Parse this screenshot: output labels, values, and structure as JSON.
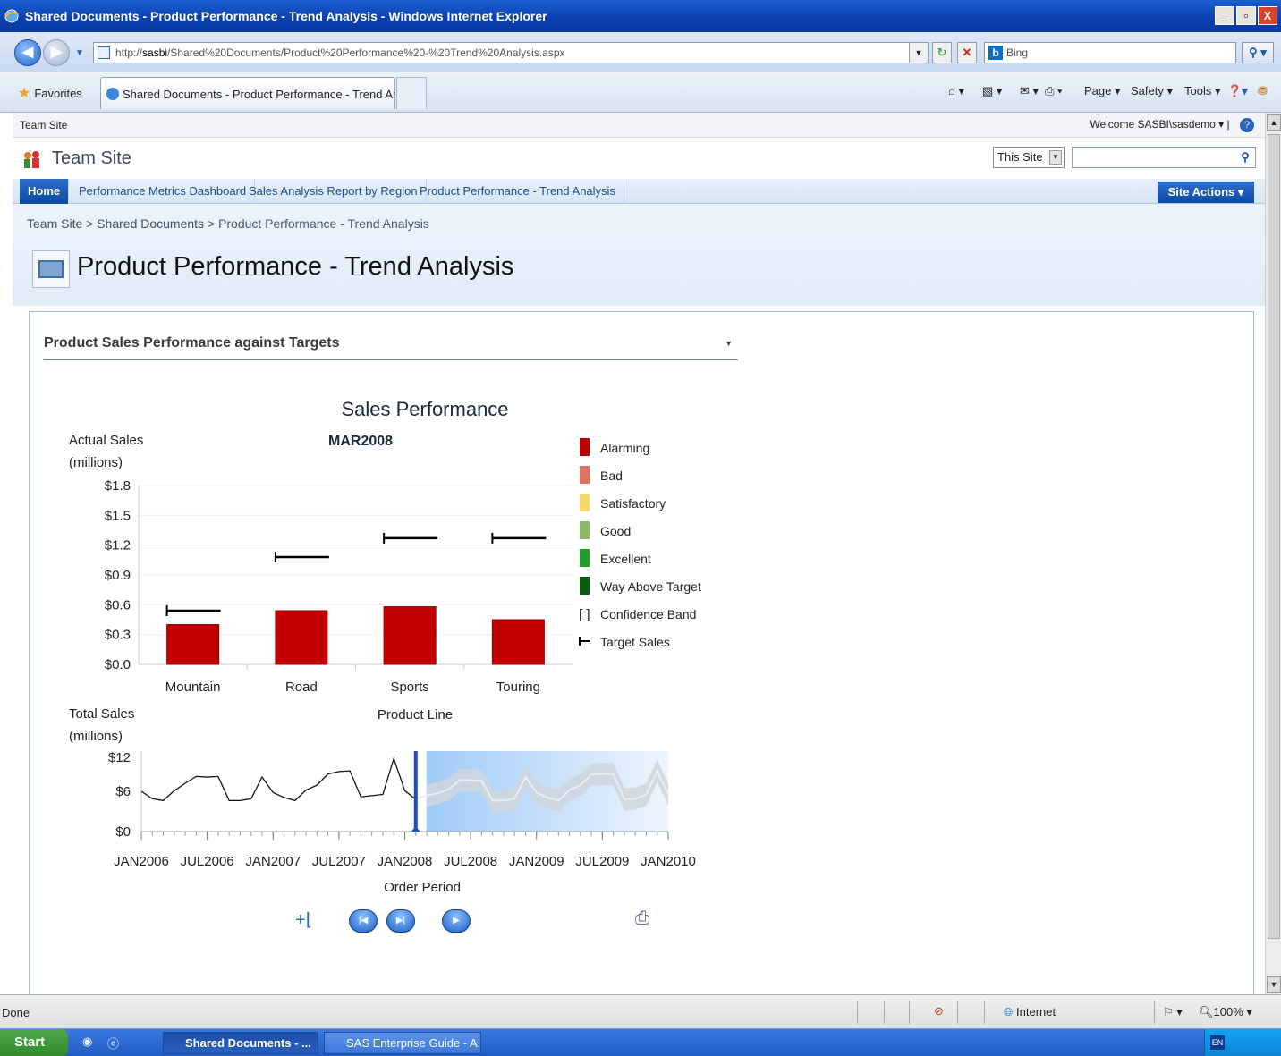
{
  "window": {
    "title": "Shared Documents - Product Performance - Trend Analysis - Windows Internet Explorer"
  },
  "browser": {
    "url_prefix": "http://",
    "url_host": "sasbi",
    "url_path": "/Shared%20Documents/Product%20Performance%20-%20Trend%20Analysis.aspx",
    "search_placeholder": "Bing",
    "favorites_label": "Favorites",
    "tab_title": "Shared Documents - Product Performance - Trend An...",
    "commands": [
      "Page",
      "Safety",
      "Tools"
    ]
  },
  "sharepoint": {
    "top_left": "Team Site",
    "welcome": "Welcome SASBI\\sasdemo",
    "site_title": "Team Site",
    "scope": "This Site",
    "nav": [
      "Home",
      "Performance Metrics Dashboard",
      "Sales Analysis Report by Region",
      "Product Performance - Trend Analysis"
    ],
    "site_actions": "Site Actions",
    "breadcrumb": [
      "Team Site",
      "Shared Documents",
      "Product Performance - Trend Analysis"
    ],
    "page_title": "Product Performance - Trend Analysis",
    "webpart_title": "Product Sales Performance against Targets"
  },
  "chart_data": [
    {
      "type": "bar",
      "title": "Sales Performance",
      "subtitle": "MAR2008",
      "ylabel": "Actual Sales (millions)",
      "xlabel": "Product Line",
      "categories": [
        "Mountain",
        "Road",
        "Sports",
        "Touring"
      ],
      "series": [
        {
          "name": "Actual Sales",
          "values": [
            0.4,
            0.54,
            0.58,
            0.45
          ]
        },
        {
          "name": "Target Sales",
          "values": [
            0.54,
            1.08,
            1.27,
            1.27
          ]
        }
      ],
      "ylim": [
        0,
        1.8
      ],
      "yticks": [
        "$1.8",
        "$1.5",
        "$1.2",
        "$0.9",
        "$0.6",
        "$0.3",
        "$0.0"
      ],
      "legend": [
        {
          "label": "Alarming",
          "color": "#c00000"
        },
        {
          "label": "Bad",
          "color": "#e07060"
        },
        {
          "label": "Satisfactory",
          "color": "#f5d76e"
        },
        {
          "label": "Good",
          "color": "#8cb862"
        },
        {
          "label": "Excellent",
          "color": "#1f9e2a"
        },
        {
          "label": "Way Above Target",
          "color": "#0c5c12"
        },
        {
          "label": "Confidence Band",
          "symbol": "[ ]"
        },
        {
          "label": "Target Sales",
          "symbol": "target-marker"
        }
      ],
      "legend_position": "right"
    },
    {
      "type": "line",
      "ylabel": "Total Sales (millions)",
      "xlabel": "Order Period",
      "xticks": [
        "JAN2006",
        "JUL2006",
        "JAN2007",
        "JUL2007",
        "JAN2008",
        "JUL2008",
        "JAN2009",
        "JUL2009",
        "JAN2010"
      ],
      "yticks": [
        "$12",
        "$6",
        "$0"
      ],
      "ylim": [
        0,
        13
      ],
      "selected_period": "MAR2008",
      "actual": [
        6.5,
        5.3,
        5.0,
        6.6,
        7.8,
        8.9,
        8.8,
        8.9,
        5.0,
        5.0,
        5.3,
        8.8,
        6.3,
        5.5,
        5.0,
        6.7,
        7.5,
        9.3,
        9.7,
        9.8,
        5.6,
        5.8,
        6.0,
        11.8,
        6.6,
        5.2
      ],
      "forecast": [
        5.8,
        6.2,
        6.8,
        8.3,
        8.3,
        8.2,
        5.0,
        5.0,
        5.3,
        8.8,
        6.3,
        5.5,
        5.0,
        6.7,
        7.5,
        9.2,
        9.3,
        9.3,
        5.2,
        5.3,
        6.0,
        9.8,
        6.0
      ],
      "forecast_band_width": 1.8
    }
  ],
  "status": {
    "left": "Done",
    "zone": "Internet",
    "zoom": "100%"
  },
  "taskbar": {
    "start": "Start",
    "tasks": [
      "Shared Documents - ...",
      "SAS Enterprise Guide - A..."
    ],
    "lang": "EN"
  }
}
